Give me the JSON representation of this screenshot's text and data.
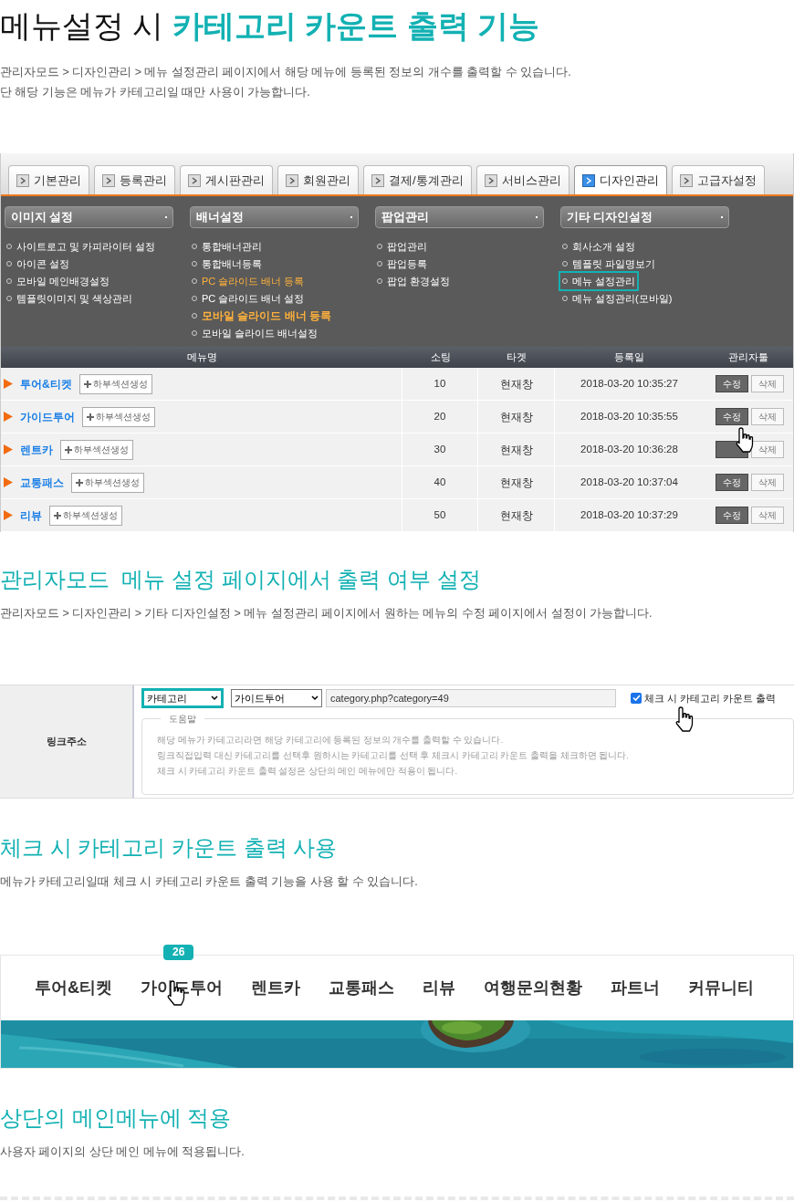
{
  "header": {
    "title_plain": "메뉴설정 시",
    "title_highlight": "카테고리 카운트 출력 기능",
    "lines": [
      "관리자모드 > 디자인관리 > 메뉴 설정관리 페이지에서 해당 메뉴에 등록된 정보의 개수를 출력할 수 있습니다.",
      "단 해당 기능은 메뉴가 카테고리일 때만 사용이 가능합니다."
    ]
  },
  "admin": {
    "tabs": [
      {
        "label": "기본관리",
        "selected": false
      },
      {
        "label": "등록관리",
        "selected": false
      },
      {
        "label": "게시판관리",
        "selected": false
      },
      {
        "label": "회원관리",
        "selected": false
      },
      {
        "label": "결제/통계관리",
        "selected": false
      },
      {
        "label": "서비스관리",
        "selected": false
      },
      {
        "label": "디자인관리",
        "selected": true
      },
      {
        "label": "고급자설정",
        "selected": false
      }
    ],
    "menu_groups": [
      {
        "title": "이미지 설정",
        "items": [
          {
            "label": "사이트로고 및 카피라이터 설정",
            "kind": "plain",
            "selected": false
          },
          {
            "label": "아이콘 설정",
            "kind": "plain",
            "selected": false
          },
          {
            "label": "모바일 메인배경설정",
            "kind": "plain",
            "selected": false
          },
          {
            "label": "템플릿이미지 및 색상관리",
            "kind": "plain",
            "selected": false
          }
        ]
      },
      {
        "title": "배너설정",
        "items": [
          {
            "label": "통합배너관리",
            "kind": "plain",
            "selected": false
          },
          {
            "label": "통합배너등록",
            "kind": "plain",
            "selected": false
          },
          {
            "label": "PC 슬라이드 배너 등록",
            "kind": "accent",
            "selected": false
          },
          {
            "label": "PC 슬라이드 배너 설정",
            "kind": "plain",
            "selected": false
          },
          {
            "label": "모바일 슬라이드 배너 등록",
            "kind": "strong",
            "selected": false
          },
          {
            "label": "모바일 슬라이드 배너설정",
            "kind": "plain",
            "selected": false
          }
        ]
      },
      {
        "title": "팝업관리",
        "items": [
          {
            "label": "팝업관리",
            "kind": "plain",
            "selected": false
          },
          {
            "label": "팝업등록",
            "kind": "plain",
            "selected": false
          },
          {
            "label": "팝업 환경설정",
            "kind": "plain",
            "selected": false
          }
        ]
      },
      {
        "title": "기타 디자인설정",
        "items": [
          {
            "label": "회사소개 설정",
            "kind": "plain",
            "selected": false
          },
          {
            "label": "템플릿 파일명보기",
            "kind": "plain",
            "selected": false
          },
          {
            "label": "메뉴 설정관리",
            "kind": "plain",
            "selected": true
          },
          {
            "label": "메뉴 설정관리(모바일)",
            "kind": "plain",
            "selected": false
          }
        ]
      }
    ],
    "table": {
      "columns": [
        "메뉴명",
        "소팅",
        "타겟",
        "등록일",
        "관리자툴"
      ],
      "rows": [
        {
          "name": "투어&티켓",
          "add": "하부섹션생성",
          "sort": "10",
          "target": "현재창",
          "date": "2018-03-20 10:35:27",
          "edit": "수정",
          "delete": "삭제"
        },
        {
          "name": "가이드투어",
          "add": "하부섹션생성",
          "sort": "20",
          "target": "현재창",
          "date": "2018-03-20 10:35:55",
          "edit": "수정",
          "delete": "삭제"
        },
        {
          "name": "렌트카",
          "add": "하부섹션생성",
          "sort": "30",
          "target": "현재창",
          "date": "2018-03-20 10:36:28",
          "delete": "삭제"
        },
        {
          "name": "교통패스",
          "add": "하부섹션생성",
          "sort": "40",
          "target": "현재창",
          "date": "2018-03-20 10:37:04",
          "edit": "수정",
          "delete": "삭제"
        },
        {
          "name": "리뷰",
          "add": "하부섹션생성",
          "sort": "50",
          "target": "현재창",
          "date": "2018-03-20 10:37:29",
          "edit": "수정",
          "delete": "삭제"
        }
      ]
    }
  },
  "section2": {
    "heading": "관리자모드  메뉴 설정 페이지에서 출력 여부 설정",
    "text": "관리자모드 > 디자인관리 > 기타 디자인설정 > 메뉴 설정관리 페이지에서 원하는 메뉴의 수정 페이지에서 설정이 가능합니다."
  },
  "form": {
    "label": "링크주소",
    "type_select": {
      "value": "카테고리",
      "selected": true
    },
    "menu_select": {
      "value": "가이드투어",
      "selected": false
    },
    "url": "category.php?category=49",
    "checkbox": {
      "label": "체크 시 카테고리 카운트 출력",
      "checked": true
    },
    "help": {
      "title": "도움말",
      "lines": [
        "해당 메뉴가 카테고리라면 해당 카테고리에 등록된 정보의 개수를 출력할 수 있습니다.",
        "링크직접입력 대신 카테고리를 선택후 원하시는 카테고리를 선택 후 체크시 카테고리 카운트 출력을 체크하면 됩니다.",
        "체크 시 카테고리 카운트 출력 설정은 상단의 메인 메뉴에만 적용이 됩니다."
      ]
    }
  },
  "section3": {
    "heading": "체크 시 카테고리 카운트 출력 사용",
    "text": "메뉴가 카테고리일때 체크 시 카테고리 카운트 출력 기능을 사용 할 수 있습니다."
  },
  "site_menu": {
    "items": [
      {
        "label": "투어&티켓"
      },
      {
        "label": "가이드투어",
        "count": "26"
      },
      {
        "label": "렌트카"
      },
      {
        "label": "교통패스"
      },
      {
        "label": "리뷰"
      },
      {
        "label": "여행문의현황"
      },
      {
        "label": "파트너"
      },
      {
        "label": "커뮤니티"
      }
    ]
  },
  "section4": {
    "heading": "상단의 메인메뉴에 적용",
    "text": "사용자 페이지의 상단 메인 메뉴에 적용됩니다."
  }
}
